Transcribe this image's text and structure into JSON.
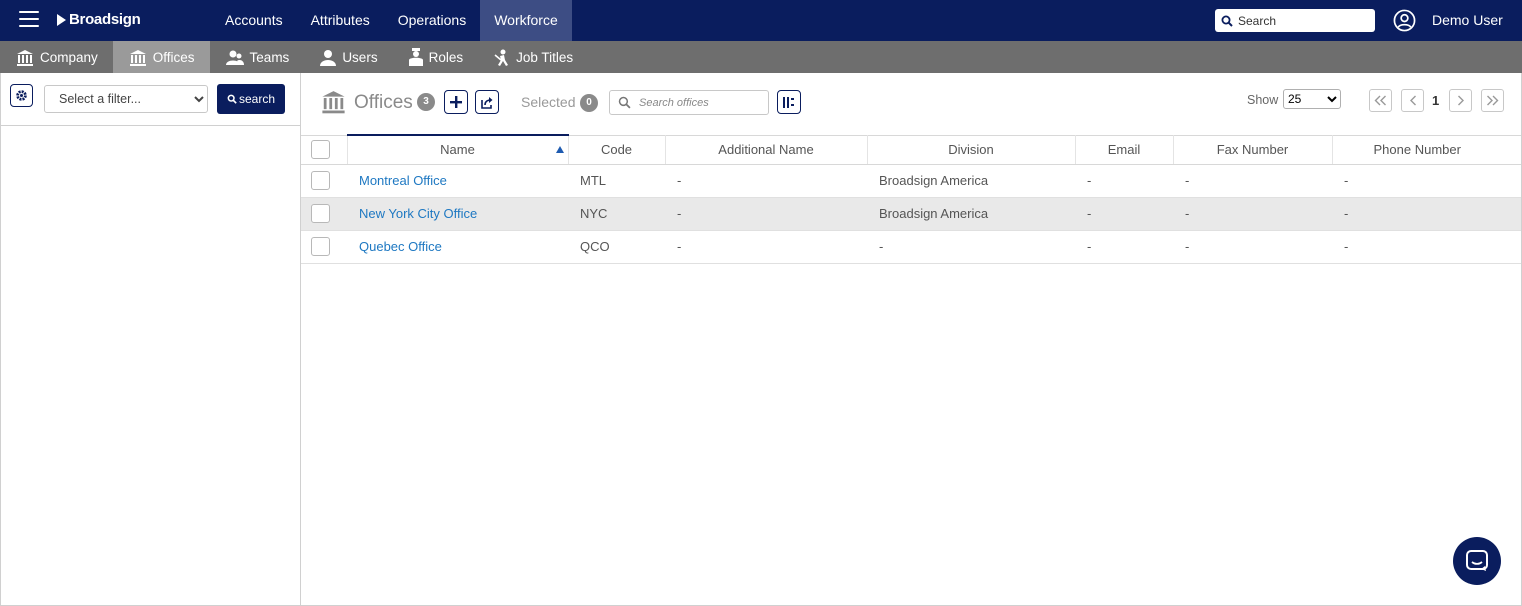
{
  "topbar": {
    "brand": "Broadsign",
    "nav": [
      {
        "label": "Accounts",
        "active": false
      },
      {
        "label": "Attributes",
        "active": false
      },
      {
        "label": "Operations",
        "active": false
      },
      {
        "label": "Workforce",
        "active": true
      }
    ],
    "search_placeholder": "Search",
    "user_name": "Demo User",
    "colors": {
      "background": "#0a1d5e",
      "active_tab": "#3d4d84"
    }
  },
  "subnav": [
    {
      "label": "Company",
      "icon": "building-icon",
      "active": false
    },
    {
      "label": "Offices",
      "icon": "building-icon",
      "active": true
    },
    {
      "label": "Teams",
      "icon": "team-icon",
      "active": false
    },
    {
      "label": "Users",
      "icon": "user-icon",
      "active": false
    },
    {
      "label": "Roles",
      "icon": "role-icon",
      "active": false
    },
    {
      "label": "Job Titles",
      "icon": "job-title-icon",
      "active": false
    }
  ],
  "filter_panel": {
    "filter_placeholder": "Select a filter...",
    "search_label": "search"
  },
  "offices": {
    "title": "Offices",
    "count": "3",
    "selected_label": "Selected",
    "selected_count": "0",
    "search_placeholder": "Search offices",
    "show_label": "Show",
    "page_size": "25",
    "page": "1",
    "columns": [
      "Name",
      "Code",
      "Additional Name",
      "Division",
      "Email",
      "Fax Number",
      "Phone Number"
    ],
    "rows": [
      {
        "name": "Montreal Office",
        "code": "MTL",
        "additional_name": "-",
        "division": "Broadsign America",
        "email": "-",
        "fax": "-",
        "phone": "-"
      },
      {
        "name": "New York City Office",
        "code": "NYC",
        "additional_name": "-",
        "division": "Broadsign America",
        "email": "-",
        "fax": "-",
        "phone": "-"
      },
      {
        "name": "Quebec Office",
        "code": "QCO",
        "additional_name": "-",
        "division": "-",
        "email": "-",
        "fax": "-",
        "phone": "-"
      }
    ],
    "highlighted_row": 1
  }
}
